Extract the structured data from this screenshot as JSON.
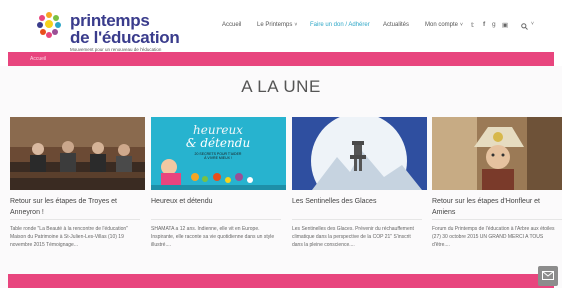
{
  "logo": {
    "line1": "printemps",
    "line2": "de l'éducation",
    "tagline": "Mouvement pour un renouveau de l'éducation"
  },
  "nav": {
    "items": [
      "Accueil",
      "Le Printemps",
      "Faire un don / Adhérer",
      "Actualités",
      "Mon compte"
    ],
    "social": [
      "twitter-icon",
      "facebook-icon",
      "google-plus-icon",
      "youtube-icon"
    ],
    "active_color": "#2ea7c7"
  },
  "breadcrumb": "Accueil",
  "section_title": "A LA UNE",
  "accent_color": "#e8457e",
  "cards": [
    {
      "title": "Retour sur les étapes de Troyes et Anneyron !",
      "excerpt": "Table ronde \"La Beauté à la rencontre de l'éducation\" Maison du Patrimoine à St-Julien-Les-Villas (10) 19 novembre 2015 Témoignage..."
    },
    {
      "title": "Heureux et détendu",
      "excerpt": "SHAMATA a 12 ans. Indienne, elle vit en Europe. Inspirante, elle raconte sa vie quotidienne dans un style illustré....",
      "image_text": [
        "heureux",
        "& détendu",
        "20 SECRETS POUR T'AIDER",
        "À VIVRE MIEUX !"
      ]
    },
    {
      "title": "Les Sentinelles des Glaces",
      "excerpt": "Les Sentinelles des Glaces. Prévenir du réchauffement climatique dans la perspective de la COP 21\" S'inscrit dans la pleine conscience...."
    },
    {
      "title": "Retour sur les étapes d'Honfleur et Amiens",
      "excerpt": "Forum du Printemps de l'éducation à l'Arbre aux étoiles (27) 30 octobre 2015 UN GRAND MERCI A TOUS d'être...."
    }
  ]
}
